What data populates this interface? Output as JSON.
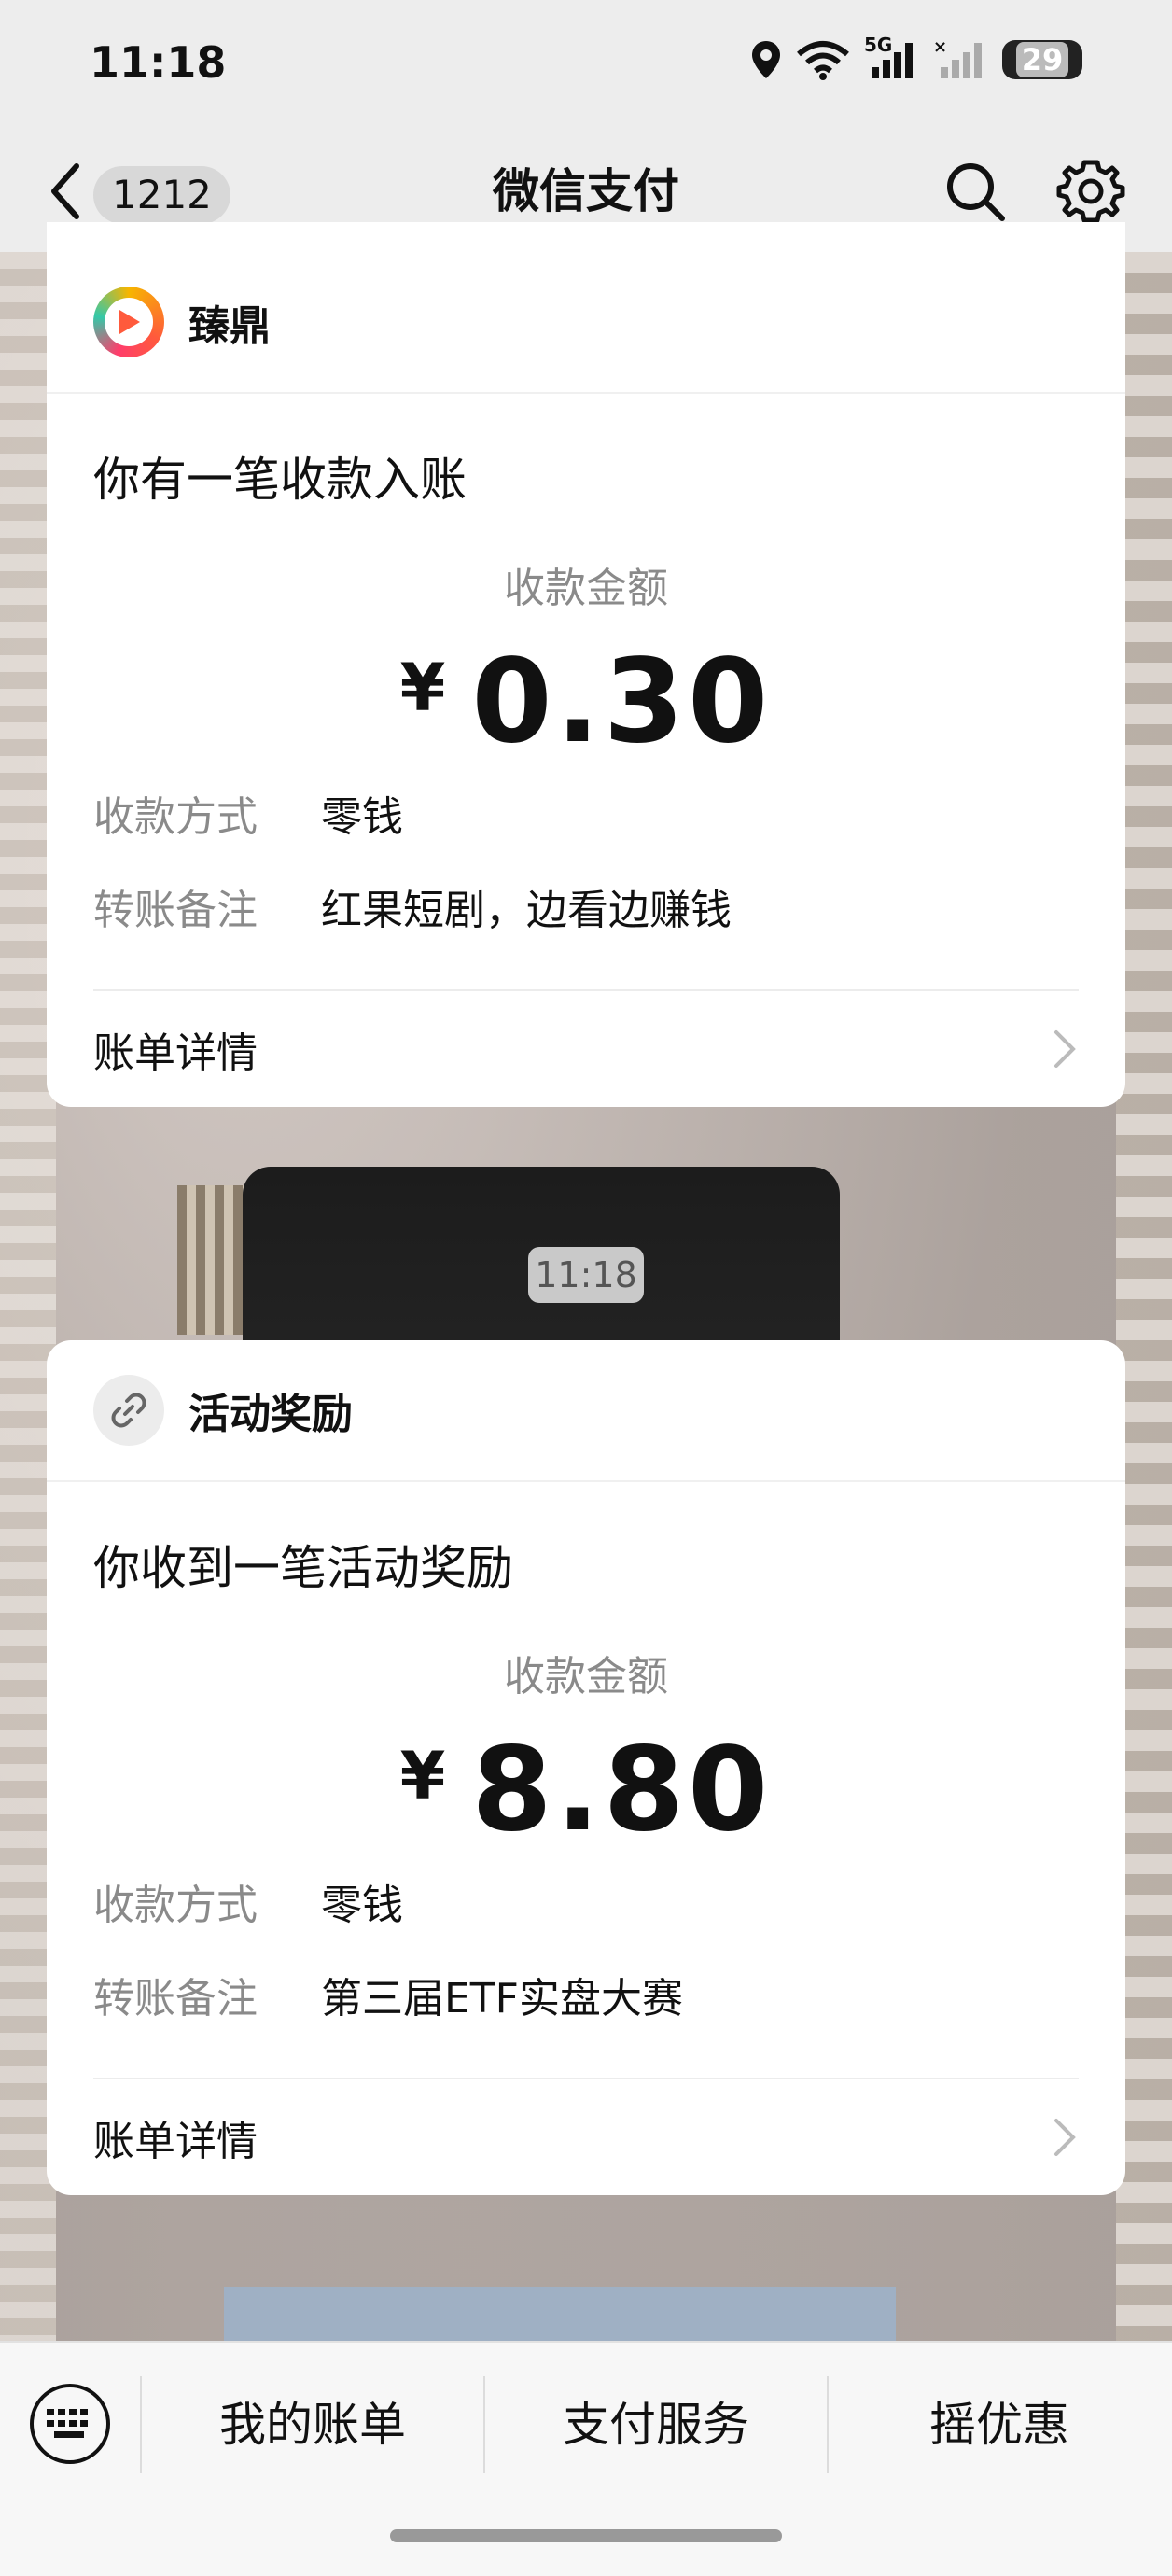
{
  "status_bar": {
    "time": "11:18",
    "network": "5G",
    "battery": "29"
  },
  "nav": {
    "unread_count": "1212",
    "title": "微信支付"
  },
  "messages": [
    {
      "source_name": "臻鼎",
      "source_icon": "play-logo-icon",
      "headline": "你有一笔收款入账",
      "amount_label": "收款金额",
      "currency": "¥",
      "amount": "0.30",
      "method_label": "收款方式",
      "method_value": "零钱",
      "note_label": "转账备注",
      "note_value": "红果短剧，边看边赚钱",
      "detail_label": "账单详情"
    },
    {
      "source_name": "活动奖励",
      "source_icon": "link-icon",
      "headline": "你收到一笔活动奖励",
      "amount_label": "收款金额",
      "currency": "¥",
      "amount": "8.80",
      "method_label": "收款方式",
      "method_value": "零钱",
      "note_label": "转账备注",
      "note_value": "第三届ETF实盘大赛",
      "detail_label": "账单详情"
    }
  ],
  "timestamp": "11:18",
  "bottom_menu": {
    "items": [
      "我的账单",
      "支付服务",
      "摇优惠"
    ]
  },
  "colors": {
    "background": "#ededed",
    "card": "#ffffff",
    "muted_text": "#8a8a8a"
  }
}
